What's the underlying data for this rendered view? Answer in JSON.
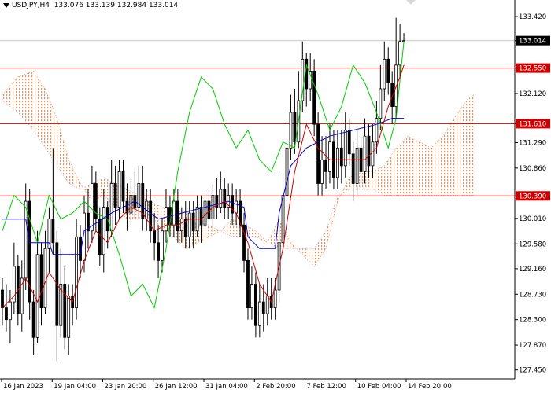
{
  "header": {
    "symbol": "USDJPY,H4",
    "ohlc": "133.076 133.139 132.984 133.014"
  },
  "colors": {
    "background": "#ffffff",
    "candle": "#000000",
    "tenkan": "#cc0000",
    "kijun": "#0000cc",
    "chikou": "#00cc00",
    "senkou_a": "#e08a50",
    "senkou_b": "#c8a8d0",
    "level_line": "#cc0000",
    "price_tag": "#000000",
    "level_tag": "#cc0000"
  },
  "chart_data": {
    "type": "candlestick",
    "title": "USDJPY,H4",
    "ylim": [
      127.3,
      133.7
    ],
    "y_ticks": [
      "133.420",
      "133.014",
      "132.550",
      "132.120",
      "131.610",
      "131.290",
      "130.860",
      "130.390",
      "130.010",
      "129.580",
      "129.160",
      "128.730",
      "128.300",
      "127.870",
      "127.450"
    ],
    "x_ticks": [
      "16 Jan 2023",
      "19 Jan 04:00",
      "23 Jan 20:00",
      "26 Jan 12:00",
      "31 Jan 04:00",
      "2 Feb 20:00",
      "7 Feb 12:00",
      "10 Feb 04:00",
      "14 Feb 20:00"
    ],
    "current_price": 133.014,
    "levels": [
      132.55,
      131.61,
      130.39
    ],
    "indicator": "Ichimoku Kinko Hyo",
    "candles": [
      [
        128.8,
        128.5,
        129.0,
        128.2
      ],
      [
        128.5,
        128.3,
        128.9,
        128.1
      ],
      [
        128.3,
        128.6,
        128.8,
        127.9
      ],
      [
        128.6,
        129.2,
        129.6,
        128.4
      ],
      [
        129.2,
        128.4,
        129.4,
        128.2
      ],
      [
        128.4,
        129.0,
        129.3,
        128.1
      ],
      [
        129.0,
        130.3,
        130.6,
        128.8
      ],
      [
        130.3,
        128.6,
        130.5,
        128.3
      ],
      [
        128.6,
        128.0,
        128.8,
        127.7
      ],
      [
        128.0,
        129.4,
        129.8,
        127.9
      ],
      [
        129.4,
        128.5,
        129.6,
        128.2
      ],
      [
        128.5,
        129.5,
        129.8,
        128.4
      ],
      [
        129.5,
        130.0,
        130.2,
        129.1
      ],
      [
        130.0,
        129.6,
        131.2,
        129.4
      ],
      [
        129.6,
        128.2,
        129.8,
        127.6
      ],
      [
        128.2,
        128.9,
        129.5,
        128.0
      ],
      [
        128.9,
        128.0,
        129.2,
        127.8
      ],
      [
        128.0,
        128.7,
        128.9,
        127.7
      ],
      [
        128.7,
        128.5,
        128.9,
        128.2
      ],
      [
        128.5,
        129.7,
        130.0,
        128.3
      ],
      [
        129.7,
        129.3,
        129.9,
        129.0
      ],
      [
        129.3,
        130.1,
        130.4,
        129.1
      ],
      [
        130.1,
        129.8,
        130.5,
        129.5
      ],
      [
        129.8,
        130.6,
        130.9,
        129.6
      ],
      [
        130.6,
        130.0,
        130.8,
        129.8
      ],
      [
        130.0,
        129.4,
        130.2,
        129.2
      ],
      [
        129.4,
        130.2,
        130.5,
        129.1
      ],
      [
        130.2,
        129.8,
        130.3,
        129.5
      ],
      [
        129.8,
        130.6,
        131.0,
        129.7
      ],
      [
        130.6,
        130.2,
        130.9,
        129.9
      ],
      [
        130.2,
        130.8,
        131.0,
        130.0
      ],
      [
        130.8,
        130.3,
        131.0,
        130.1
      ],
      [
        130.3,
        130.1,
        130.6,
        129.8
      ],
      [
        130.1,
        130.4,
        130.7,
        129.9
      ],
      [
        130.4,
        130.2,
        130.8,
        130.0
      ],
      [
        130.2,
        130.6,
        130.9,
        130.0
      ],
      [
        130.6,
        130.0,
        130.9,
        129.8
      ],
      [
        130.0,
        130.3,
        130.5,
        129.8
      ],
      [
        130.3,
        129.8,
        130.5,
        129.6
      ],
      [
        129.8,
        129.6,
        130.1,
        129.3
      ],
      [
        129.6,
        129.3,
        129.9,
        129.0
      ],
      [
        129.3,
        129.8,
        130.0,
        129.1
      ],
      [
        129.8,
        130.2,
        130.5,
        129.6
      ],
      [
        130.2,
        129.9,
        130.4,
        129.7
      ],
      [
        129.9,
        130.3,
        130.5,
        129.7
      ],
      [
        130.3,
        129.8,
        130.5,
        129.6
      ],
      [
        129.8,
        130.0,
        130.2,
        129.6
      ],
      [
        130.0,
        129.7,
        130.3,
        129.5
      ],
      [
        129.7,
        130.1,
        130.3,
        129.5
      ],
      [
        130.1,
        129.8,
        130.3,
        129.5
      ],
      [
        129.8,
        130.2,
        130.4,
        129.7
      ],
      [
        130.2,
        129.9,
        130.4,
        129.6
      ],
      [
        129.9,
        130.3,
        130.5,
        129.8
      ],
      [
        130.3,
        130.0,
        130.5,
        129.8
      ],
      [
        130.0,
        130.4,
        130.6,
        129.8
      ],
      [
        130.4,
        130.2,
        130.7,
        130.0
      ],
      [
        130.2,
        130.5,
        130.8,
        130.1
      ],
      [
        130.5,
        130.2,
        130.7,
        130.0
      ],
      [
        130.2,
        130.4,
        130.6,
        130.0
      ],
      [
        130.4,
        130.1,
        130.6,
        129.9
      ],
      [
        130.1,
        130.3,
        130.5,
        129.9
      ],
      [
        130.3,
        129.9,
        130.5,
        129.7
      ],
      [
        129.9,
        129.3,
        130.1,
        129.1
      ],
      [
        129.3,
        128.5,
        129.5,
        128.3
      ],
      [
        128.5,
        128.9,
        129.2,
        128.3
      ],
      [
        128.9,
        128.2,
        129.1,
        128.0
      ],
      [
        128.2,
        128.6,
        128.9,
        128.0
      ],
      [
        128.6,
        128.4,
        128.9,
        128.1
      ],
      [
        128.4,
        128.7,
        129.0,
        128.2
      ],
      [
        128.7,
        128.5,
        129.0,
        128.3
      ],
      [
        128.5,
        128.8,
        129.0,
        128.3
      ],
      [
        128.8,
        129.6,
        129.9,
        128.6
      ],
      [
        129.6,
        130.4,
        130.8,
        129.4
      ],
      [
        130.4,
        131.2,
        131.6,
        130.2
      ],
      [
        131.2,
        131.8,
        132.1,
        131.0
      ],
      [
        131.8,
        131.3,
        132.2,
        131.1
      ],
      [
        131.3,
        132.0,
        132.5,
        131.2
      ],
      [
        132.0,
        132.7,
        133.0,
        131.8
      ],
      [
        132.7,
        132.2,
        132.8,
        131.9
      ],
      [
        132.2,
        132.5,
        132.8,
        132.0
      ],
      [
        132.5,
        131.6,
        132.7,
        131.4
      ],
      [
        131.6,
        130.6,
        131.8,
        130.4
      ],
      [
        130.6,
        131.0,
        131.4,
        130.4
      ],
      [
        131.0,
        130.8,
        131.4,
        130.5
      ],
      [
        130.8,
        131.3,
        131.6,
        130.6
      ],
      [
        131.3,
        130.7,
        131.5,
        130.5
      ],
      [
        130.7,
        131.2,
        131.5,
        130.5
      ],
      [
        131.2,
        130.9,
        131.5,
        130.6
      ],
      [
        130.9,
        131.5,
        131.8,
        130.7
      ],
      [
        131.5,
        131.1,
        131.7,
        130.9
      ],
      [
        131.1,
        130.6,
        131.3,
        130.3
      ],
      [
        130.6,
        131.2,
        131.5,
        130.4
      ],
      [
        131.2,
        130.8,
        131.4,
        130.6
      ],
      [
        130.8,
        131.4,
        131.7,
        130.6
      ],
      [
        131.4,
        130.9,
        131.6,
        130.7
      ],
      [
        130.9,
        131.3,
        131.6,
        130.7
      ],
      [
        131.3,
        131.7,
        132.0,
        131.1
      ],
      [
        131.7,
        132.2,
        132.6,
        131.5
      ],
      [
        132.2,
        132.7,
        133.0,
        132.0
      ],
      [
        132.7,
        132.3,
        132.9,
        132.1
      ],
      [
        132.3,
        131.9,
        132.5,
        131.6
      ],
      [
        131.9,
        132.6,
        133.4,
        131.7
      ],
      [
        132.6,
        133.0,
        133.3,
        132.4
      ],
      [
        133.0,
        133.014,
        133.14,
        132.98
      ]
    ],
    "tenkan": [
      [
        0,
        128.5
      ],
      [
        3,
        128.7
      ],
      [
        6,
        129.0
      ],
      [
        9,
        128.6
      ],
      [
        12,
        129.1
      ],
      [
        15,
        128.8
      ],
      [
        18,
        128.6
      ],
      [
        21,
        129.3
      ],
      [
        24,
        129.8
      ],
      [
        27,
        129.6
      ],
      [
        30,
        130.0
      ],
      [
        33,
        130.2
      ],
      [
        36,
        130.1
      ],
      [
        39,
        129.8
      ],
      [
        42,
        129.9
      ],
      [
        45,
        129.9
      ],
      [
        48,
        130.0
      ],
      [
        51,
        130.0
      ],
      [
        54,
        130.2
      ],
      [
        57,
        130.3
      ],
      [
        60,
        130.1
      ],
      [
        63,
        129.6
      ],
      [
        66,
        128.9
      ],
      [
        69,
        128.6
      ],
      [
        72,
        129.5
      ],
      [
        75,
        130.8
      ],
      [
        78,
        131.6
      ],
      [
        81,
        131.2
      ],
      [
        84,
        131.0
      ],
      [
        87,
        131.0
      ],
      [
        90,
        131.0
      ],
      [
        93,
        131.0
      ],
      [
        96,
        131.2
      ],
      [
        99,
        131.9
      ],
      [
        102,
        132.4
      ],
      [
        103,
        132.6
      ]
    ],
    "kijun": [
      [
        0,
        130.0
      ],
      [
        6,
        130.0
      ],
      [
        7,
        129.6
      ],
      [
        12,
        129.6
      ],
      [
        13,
        129.4
      ],
      [
        20,
        129.4
      ],
      [
        21,
        129.8
      ],
      [
        28,
        130.1
      ],
      [
        34,
        130.3
      ],
      [
        40,
        130.0
      ],
      [
        46,
        130.1
      ],
      [
        52,
        130.2
      ],
      [
        58,
        130.3
      ],
      [
        62,
        130.2
      ],
      [
        63,
        129.7
      ],
      [
        66,
        129.5
      ],
      [
        70,
        129.5
      ],
      [
        71,
        130.1
      ],
      [
        74,
        130.9
      ],
      [
        78,
        131.2
      ],
      [
        84,
        131.4
      ],
      [
        90,
        131.5
      ],
      [
        96,
        131.6
      ],
      [
        100,
        131.7
      ],
      [
        103,
        131.7
      ]
    ],
    "chikou": [
      [
        0,
        129.8
      ],
      [
        3,
        130.4
      ],
      [
        6,
        130.2
      ],
      [
        9,
        129.6
      ],
      [
        12,
        130.4
      ],
      [
        15,
        130.0
      ],
      [
        18,
        130.1
      ],
      [
        21,
        130.3
      ],
      [
        24,
        130.1
      ],
      [
        27,
        130.0
      ],
      [
        30,
        129.4
      ],
      [
        33,
        128.7
      ],
      [
        36,
        128.9
      ],
      [
        39,
        128.5
      ],
      [
        42,
        129.5
      ],
      [
        45,
        130.8
      ],
      [
        48,
        131.8
      ],
      [
        51,
        132.4
      ],
      [
        54,
        132.2
      ],
      [
        57,
        131.6
      ],
      [
        60,
        131.2
      ],
      [
        63,
        131.5
      ],
      [
        66,
        131.0
      ],
      [
        69,
        130.8
      ],
      [
        72,
        131.3
      ],
      [
        75,
        131.2
      ],
      [
        78,
        132.6
      ],
      [
        81,
        132.1
      ],
      [
        84,
        131.5
      ],
      [
        87,
        131.9
      ],
      [
        90,
        132.6
      ],
      [
        93,
        132.3
      ],
      [
        96,
        131.8
      ],
      [
        99,
        131.2
      ],
      [
        101,
        131.7
      ],
      [
        103,
        133.0
      ]
    ],
    "senkou_a": [
      [
        0,
        132.1
      ],
      [
        4,
        132.4
      ],
      [
        8,
        132.5
      ],
      [
        11,
        132.2
      ],
      [
        14,
        131.7
      ],
      [
        17,
        131.0
      ],
      [
        20,
        130.6
      ],
      [
        23,
        130.3
      ],
      [
        26,
        130.4
      ],
      [
        29,
        130.2
      ],
      [
        32,
        130.0
      ],
      [
        35,
        130.0
      ],
      [
        38,
        130.1
      ],
      [
        41,
        129.8
      ],
      [
        44,
        129.7
      ],
      [
        47,
        129.5
      ],
      [
        50,
        129.6
      ],
      [
        53,
        129.7
      ],
      [
        56,
        129.8
      ],
      [
        59,
        130.0
      ],
      [
        62,
        129.9
      ],
      [
        65,
        129.8
      ],
      [
        68,
        129.6
      ],
      [
        71,
        130.0
      ],
      [
        74,
        129.6
      ],
      [
        77,
        129.4
      ],
      [
        80,
        129.2
      ],
      [
        83,
        129.5
      ],
      [
        86,
        130.3
      ],
      [
        89,
        130.7
      ],
      [
        92,
        130.8
      ],
      [
        95,
        130.8
      ],
      [
        98,
        130.9
      ],
      [
        101,
        131.2
      ],
      [
        104,
        131.4
      ],
      [
        107,
        131.3
      ],
      [
        110,
        131.2
      ],
      [
        113,
        131.4
      ],
      [
        116,
        131.7
      ],
      [
        119,
        132.0
      ],
      [
        121,
        132.1
      ]
    ],
    "senkou_b": [
      [
        0,
        132.0
      ],
      [
        4,
        131.8
      ],
      [
        8,
        131.5
      ],
      [
        11,
        131.2
      ],
      [
        14,
        130.9
      ],
      [
        17,
        130.6
      ],
      [
        20,
        130.5
      ],
      [
        23,
        130.6
      ],
      [
        26,
        130.7
      ],
      [
        29,
        130.6
      ],
      [
        32,
        130.5
      ],
      [
        35,
        130.4
      ],
      [
        38,
        130.3
      ],
      [
        41,
        130.2
      ],
      [
        44,
        130.2
      ],
      [
        47,
        130.1
      ],
      [
        50,
        129.9
      ],
      [
        53,
        129.9
      ],
      [
        56,
        129.8
      ],
      [
        59,
        129.7
      ],
      [
        62,
        129.7
      ],
      [
        65,
        129.7
      ],
      [
        68,
        129.6
      ],
      [
        71,
        129.5
      ],
      [
        74,
        129.5
      ],
      [
        77,
        129.5
      ],
      [
        80,
        129.5
      ],
      [
        83,
        129.8
      ],
      [
        86,
        130.4
      ],
      [
        89,
        130.5
      ],
      [
        92,
        130.5
      ],
      [
        95,
        130.5
      ],
      [
        98,
        130.4
      ],
      [
        101,
        130.4
      ],
      [
        104,
        130.4
      ],
      [
        107,
        130.4
      ],
      [
        110,
        130.4
      ],
      [
        113,
        130.4
      ],
      [
        116,
        130.4
      ],
      [
        119,
        130.4
      ],
      [
        121,
        130.4
      ]
    ]
  }
}
